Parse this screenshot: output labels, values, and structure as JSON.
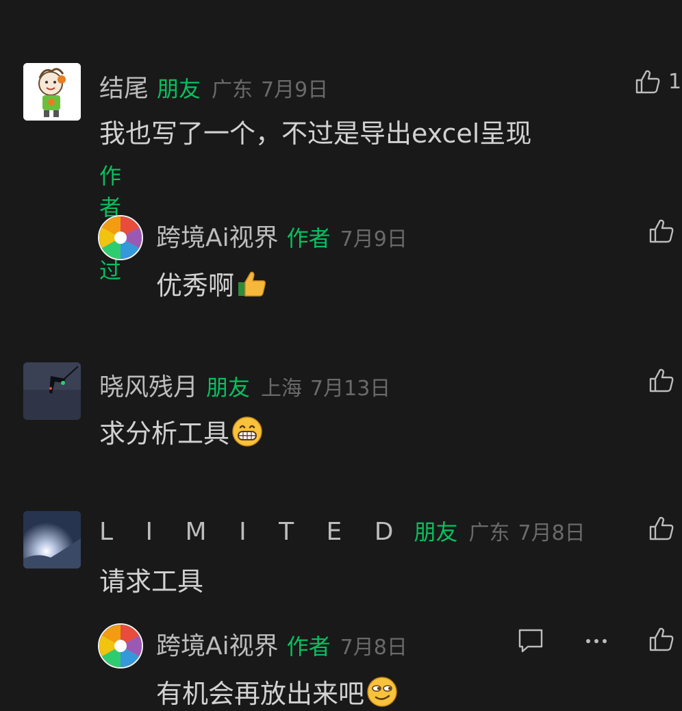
{
  "comments": [
    {
      "author": "结尾",
      "tag": "朋友",
      "region": "广东",
      "date": "7月9日",
      "text": "我也写了一个，不过是导出excel呈现",
      "liked_by_author": "作者赞过",
      "like_count": "1",
      "reply": {
        "author": "跨境Ai视界",
        "tag": "作者",
        "date": "7月9日",
        "text": "优秀啊",
        "emoji": "thumbs-up-emoji"
      }
    },
    {
      "author": "晓风残月",
      "tag": "朋友",
      "region": "上海",
      "date": "7月13日",
      "text": "求分析工具",
      "emoji": "grin-emoji"
    },
    {
      "author": "L I M I T E D",
      "tag": "朋友",
      "region": "广东",
      "date": "7月8日",
      "text": "请求工具",
      "reply": {
        "author": "跨境Ai视界",
        "tag": "作者",
        "date": "7月8日",
        "text": "有机会再放出来吧",
        "emoji": "smirk-emoji"
      }
    }
  ],
  "colors": {
    "background": "#191919",
    "friend_tag": "#07c160",
    "meta": "#6a6a6a",
    "name": "#bdbdbd",
    "text": "#d2d2d2"
  }
}
